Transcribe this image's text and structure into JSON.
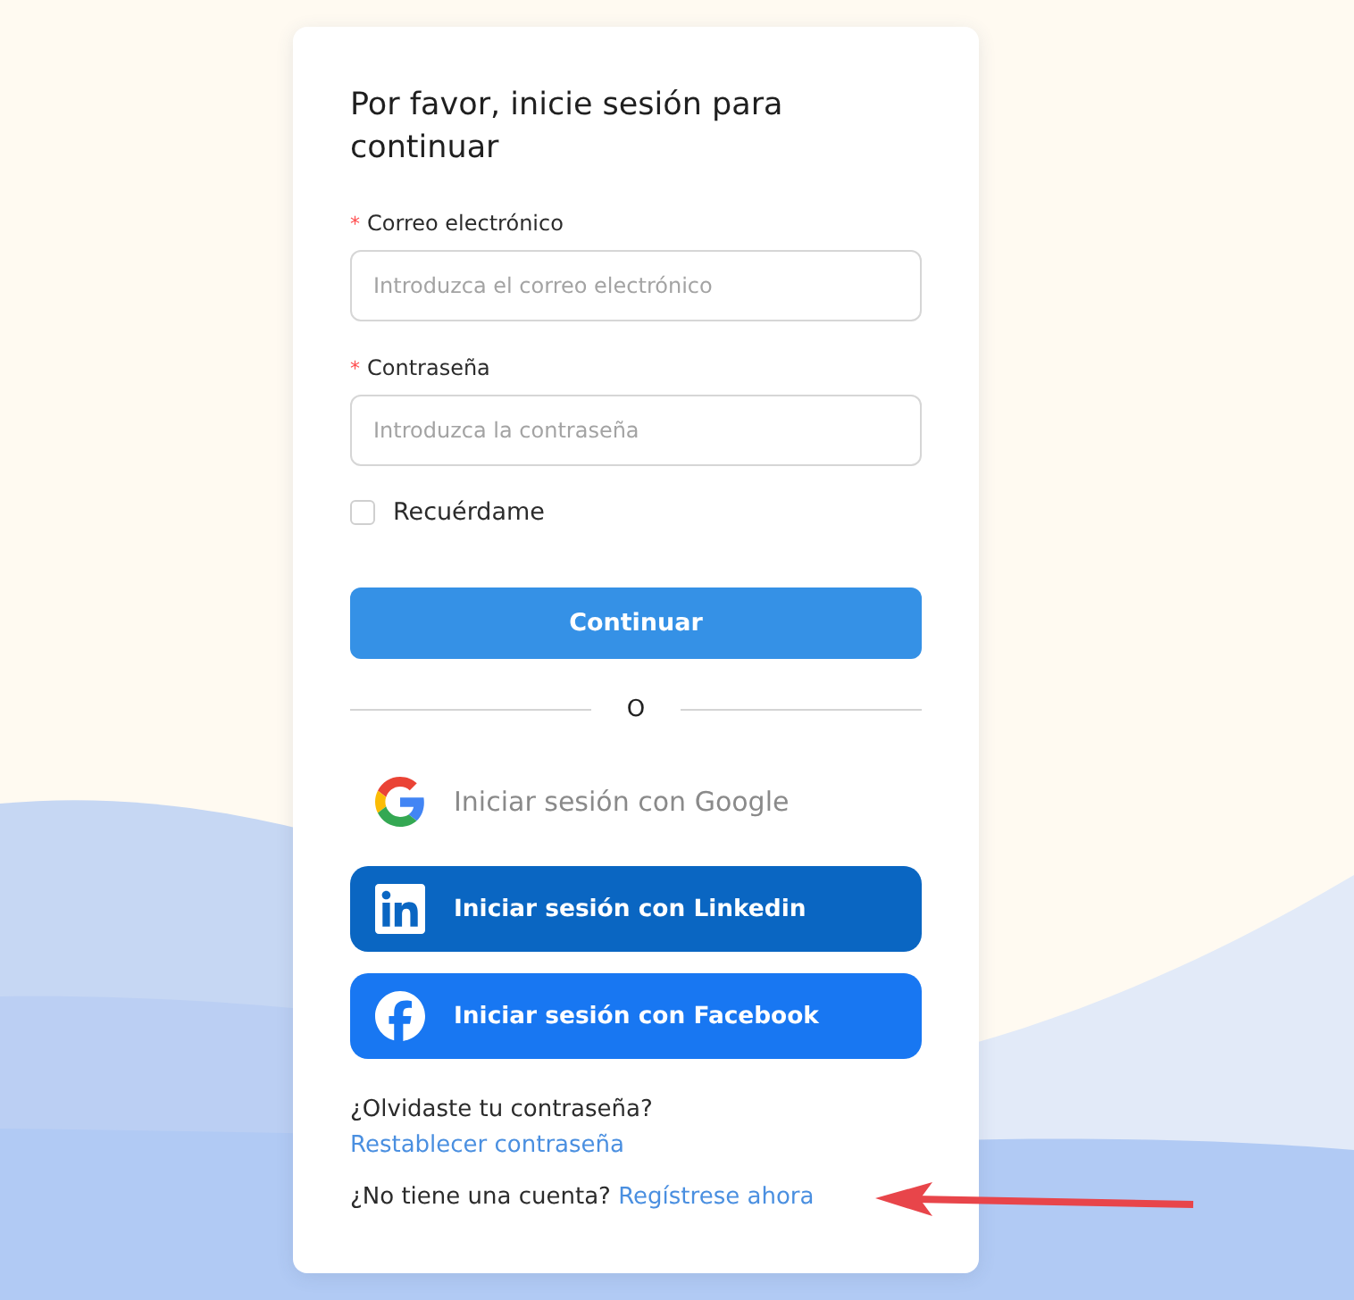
{
  "card": {
    "title": "Por favor, inicie sesión para continuar",
    "fields": [
      {
        "required_mark": "*",
        "label": "Correo electrónico",
        "placeholder": "Introduzca el correo electrónico"
      },
      {
        "required_mark": "*",
        "label": "Contraseña",
        "placeholder": "Introduzca la contraseña"
      }
    ],
    "remember": {
      "label": "Recuérdame",
      "checked": false
    },
    "submit": {
      "label": "Continuar"
    },
    "divider": {
      "label": "O"
    },
    "social_buttons": [
      {
        "kind": "google",
        "label": "Iniciar sesión con Google"
      },
      {
        "kind": "linkedin",
        "label": "Iniciar sesión con Linkedin"
      },
      {
        "kind": "facebook",
        "label": "Iniciar sesión con Facebook"
      }
    ],
    "forgot": {
      "text": "¿Olvidaste tu contraseña?",
      "link": "Restablecer contraseña"
    },
    "signup": {
      "text": "¿No tiene una cuenta?",
      "link": "Regístrese ahora"
    }
  }
}
